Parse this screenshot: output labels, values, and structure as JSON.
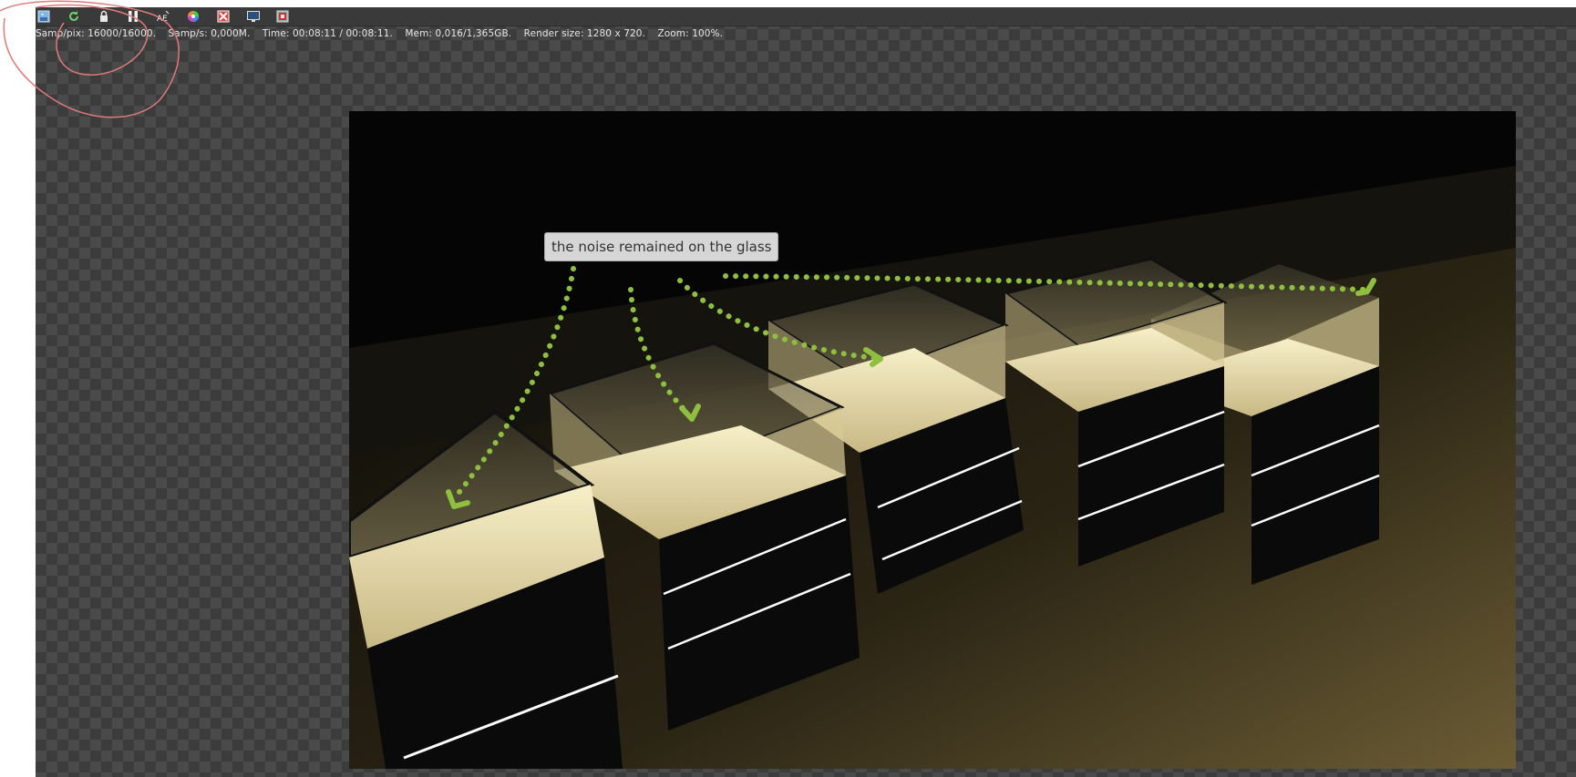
{
  "toolbar": {
    "buttons": [
      {
        "name": "save-render-button",
        "icon": "save-image-icon"
      },
      {
        "name": "restart-render-button",
        "icon": "refresh-icon"
      },
      {
        "name": "lock-button",
        "icon": "lock-icon"
      },
      {
        "name": "pause-button",
        "icon": "pause-icon"
      },
      {
        "name": "ae-button",
        "icon": "ae-text-icon",
        "label": "AE"
      },
      {
        "name": "color-button",
        "icon": "color-wheel-icon"
      },
      {
        "name": "clear-button",
        "icon": "clear-region-icon"
      },
      {
        "name": "display-button",
        "icon": "monitor-icon"
      },
      {
        "name": "settings-button",
        "icon": "film-settings-icon"
      }
    ]
  },
  "status": {
    "samp_pix": "Samp/pix: 16000/16000.",
    "samp_s": "Samp/s: 0,000M.",
    "time": "Time: 00:08:11 / 00:08:11.",
    "mem": "Mem: 0,016/1,365GB.",
    "render_size": "Render size: 1280 x 720.",
    "zoom": "Zoom: 100%."
  },
  "annotation": {
    "text": "the noise remained on the glass",
    "arrow_color": "#8fbf3f",
    "circle_color": "#e07a7a"
  }
}
